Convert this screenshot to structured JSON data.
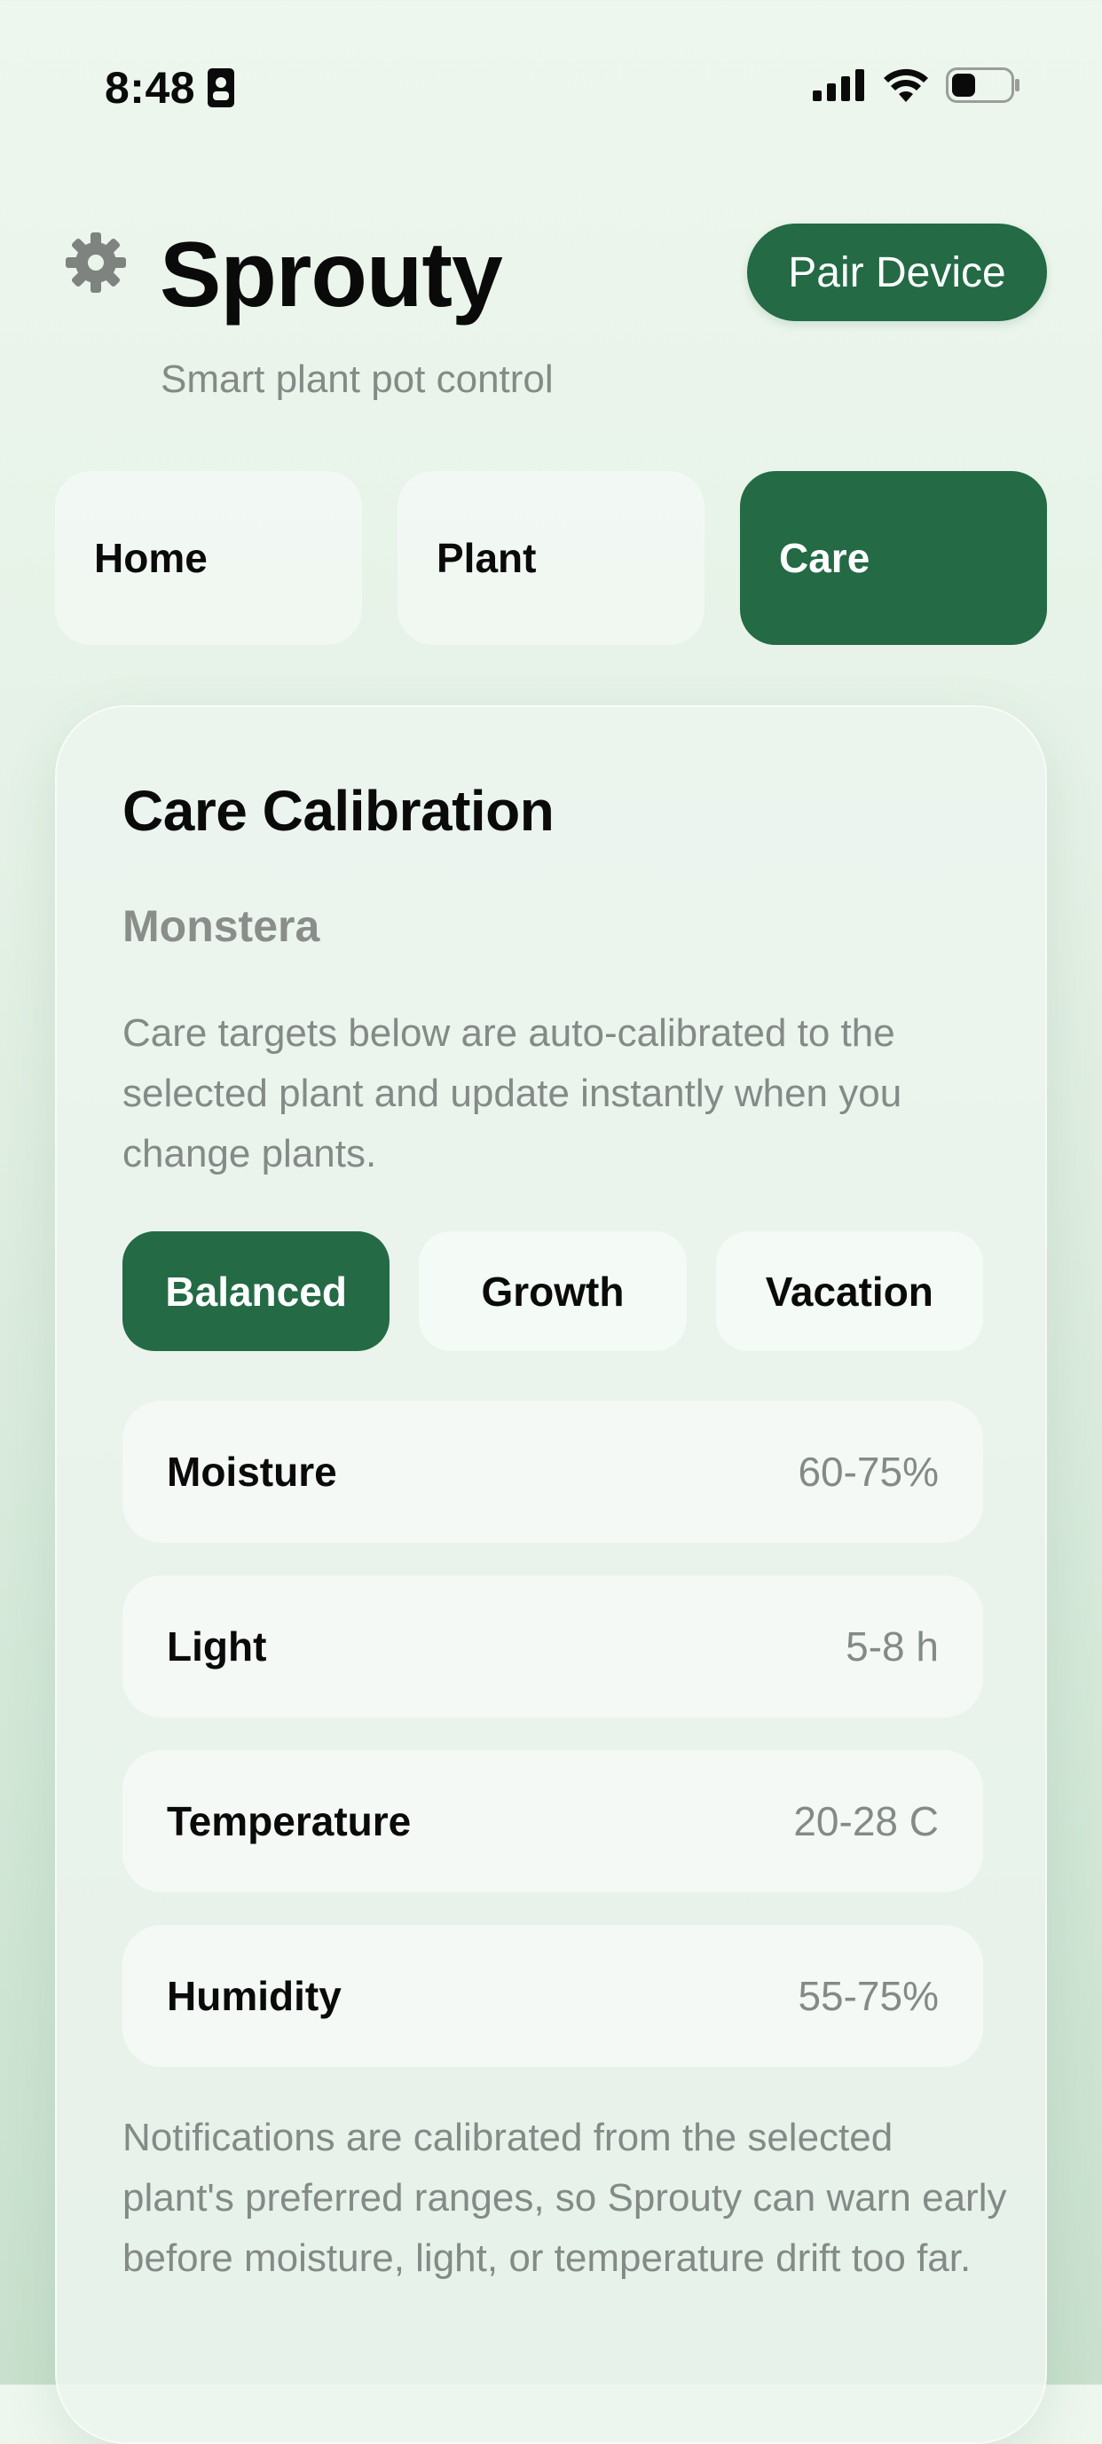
{
  "status_bar": {
    "time": "8:48"
  },
  "header": {
    "title": "Sprouty",
    "subtitle": "Smart plant pot control",
    "pair_button_label": "Pair Device"
  },
  "tabs": [
    {
      "label": "Home",
      "active": false
    },
    {
      "label": "Plant",
      "active": false
    },
    {
      "label": "Care",
      "active": true
    }
  ],
  "card": {
    "title": "Care Calibration",
    "plant_name": "Monstera",
    "description": "Care targets below are auto-calibrated to the selected plant and update instantly when you change plants.",
    "modes": [
      {
        "label": "Balanced",
        "active": true
      },
      {
        "label": "Growth",
        "active": false
      },
      {
        "label": "Vacation",
        "active": false
      }
    ],
    "targets": [
      {
        "label": "Moisture",
        "value": "60-75%"
      },
      {
        "label": "Light",
        "value": "5-8 h"
      },
      {
        "label": "Temperature",
        "value": "20-28 C"
      },
      {
        "label": "Humidity",
        "value": "55-75%"
      }
    ],
    "footer": "Notifications are calibrated from the selected plant's preferred ranges, so Sprouty can warn early before moisture, light, or temperature drift too far."
  },
  "colors": {
    "accent": "#236a45",
    "muted_text": "#848a86"
  },
  "icons": {
    "settings": "gear-icon",
    "status_id": "id-card-icon",
    "signal": "cellular-signal-icon",
    "wifi": "wifi-icon",
    "battery": "battery-icon"
  }
}
